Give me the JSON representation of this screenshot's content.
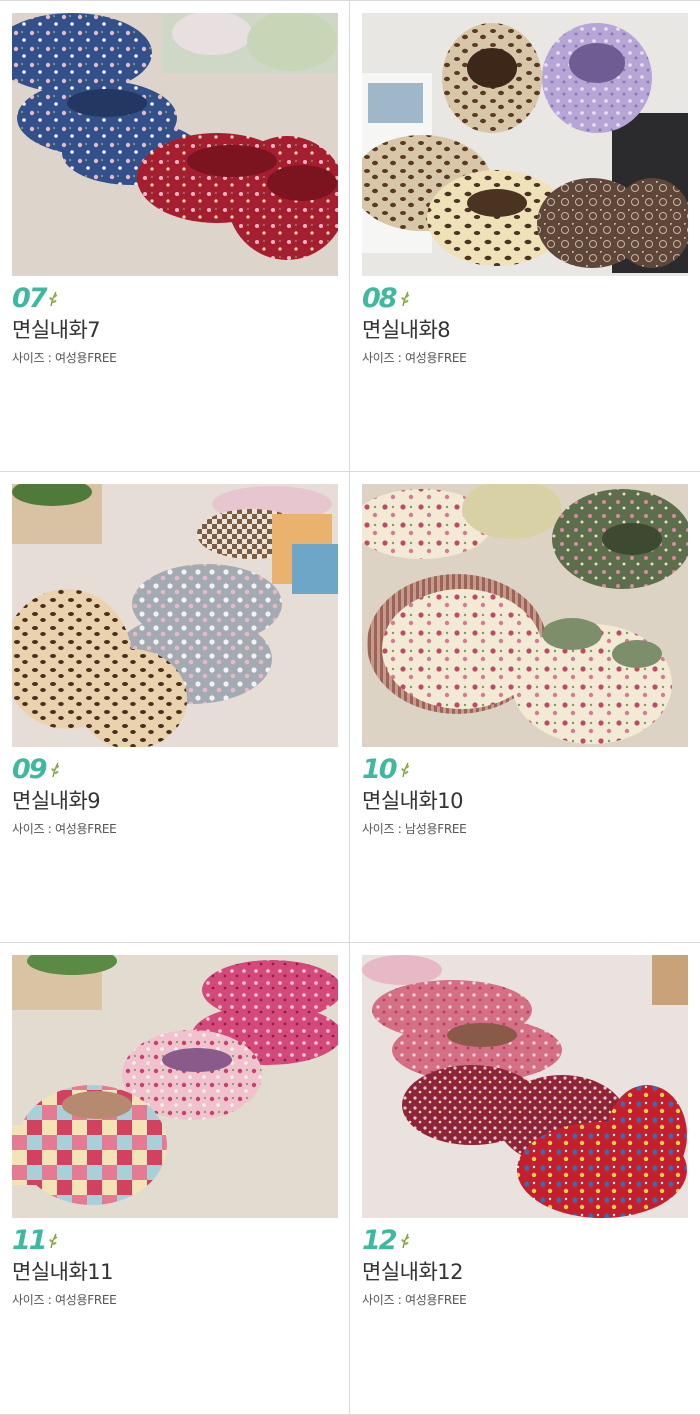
{
  "colors": {
    "accent": "#3fb8a0",
    "divider": "#d9d9d9",
    "text": "#333333"
  },
  "products": [
    {
      "num": "07",
      "name": "면실내화7",
      "size": "사이즈 : 여성용FREE",
      "photo": "floral-navy-and-red-slippers"
    },
    {
      "num": "08",
      "name": "면실내화8",
      "size": "사이즈 : 여성용FREE",
      "photo": "leopard-and-lilac-slippers"
    },
    {
      "num": "09",
      "name": "면실내화9",
      "size": "사이즈 : 여성용FREE",
      "photo": "leopard-and-gray-polka-dot-slippers"
    },
    {
      "num": "10",
      "name": "면실내화10",
      "size": "사이즈 : 남성용FREE",
      "photo": "rose-cream-and-green-floral-slippers"
    },
    {
      "num": "11",
      "name": "면실내화11",
      "size": "사이즈 : 여성용FREE",
      "photo": "pink-floral-patchwork-slippers"
    },
    {
      "num": "12",
      "name": "면실내화12",
      "size": "사이즈 : 여성용FREE",
      "photo": "pink-and-red-floral-slippers"
    }
  ]
}
